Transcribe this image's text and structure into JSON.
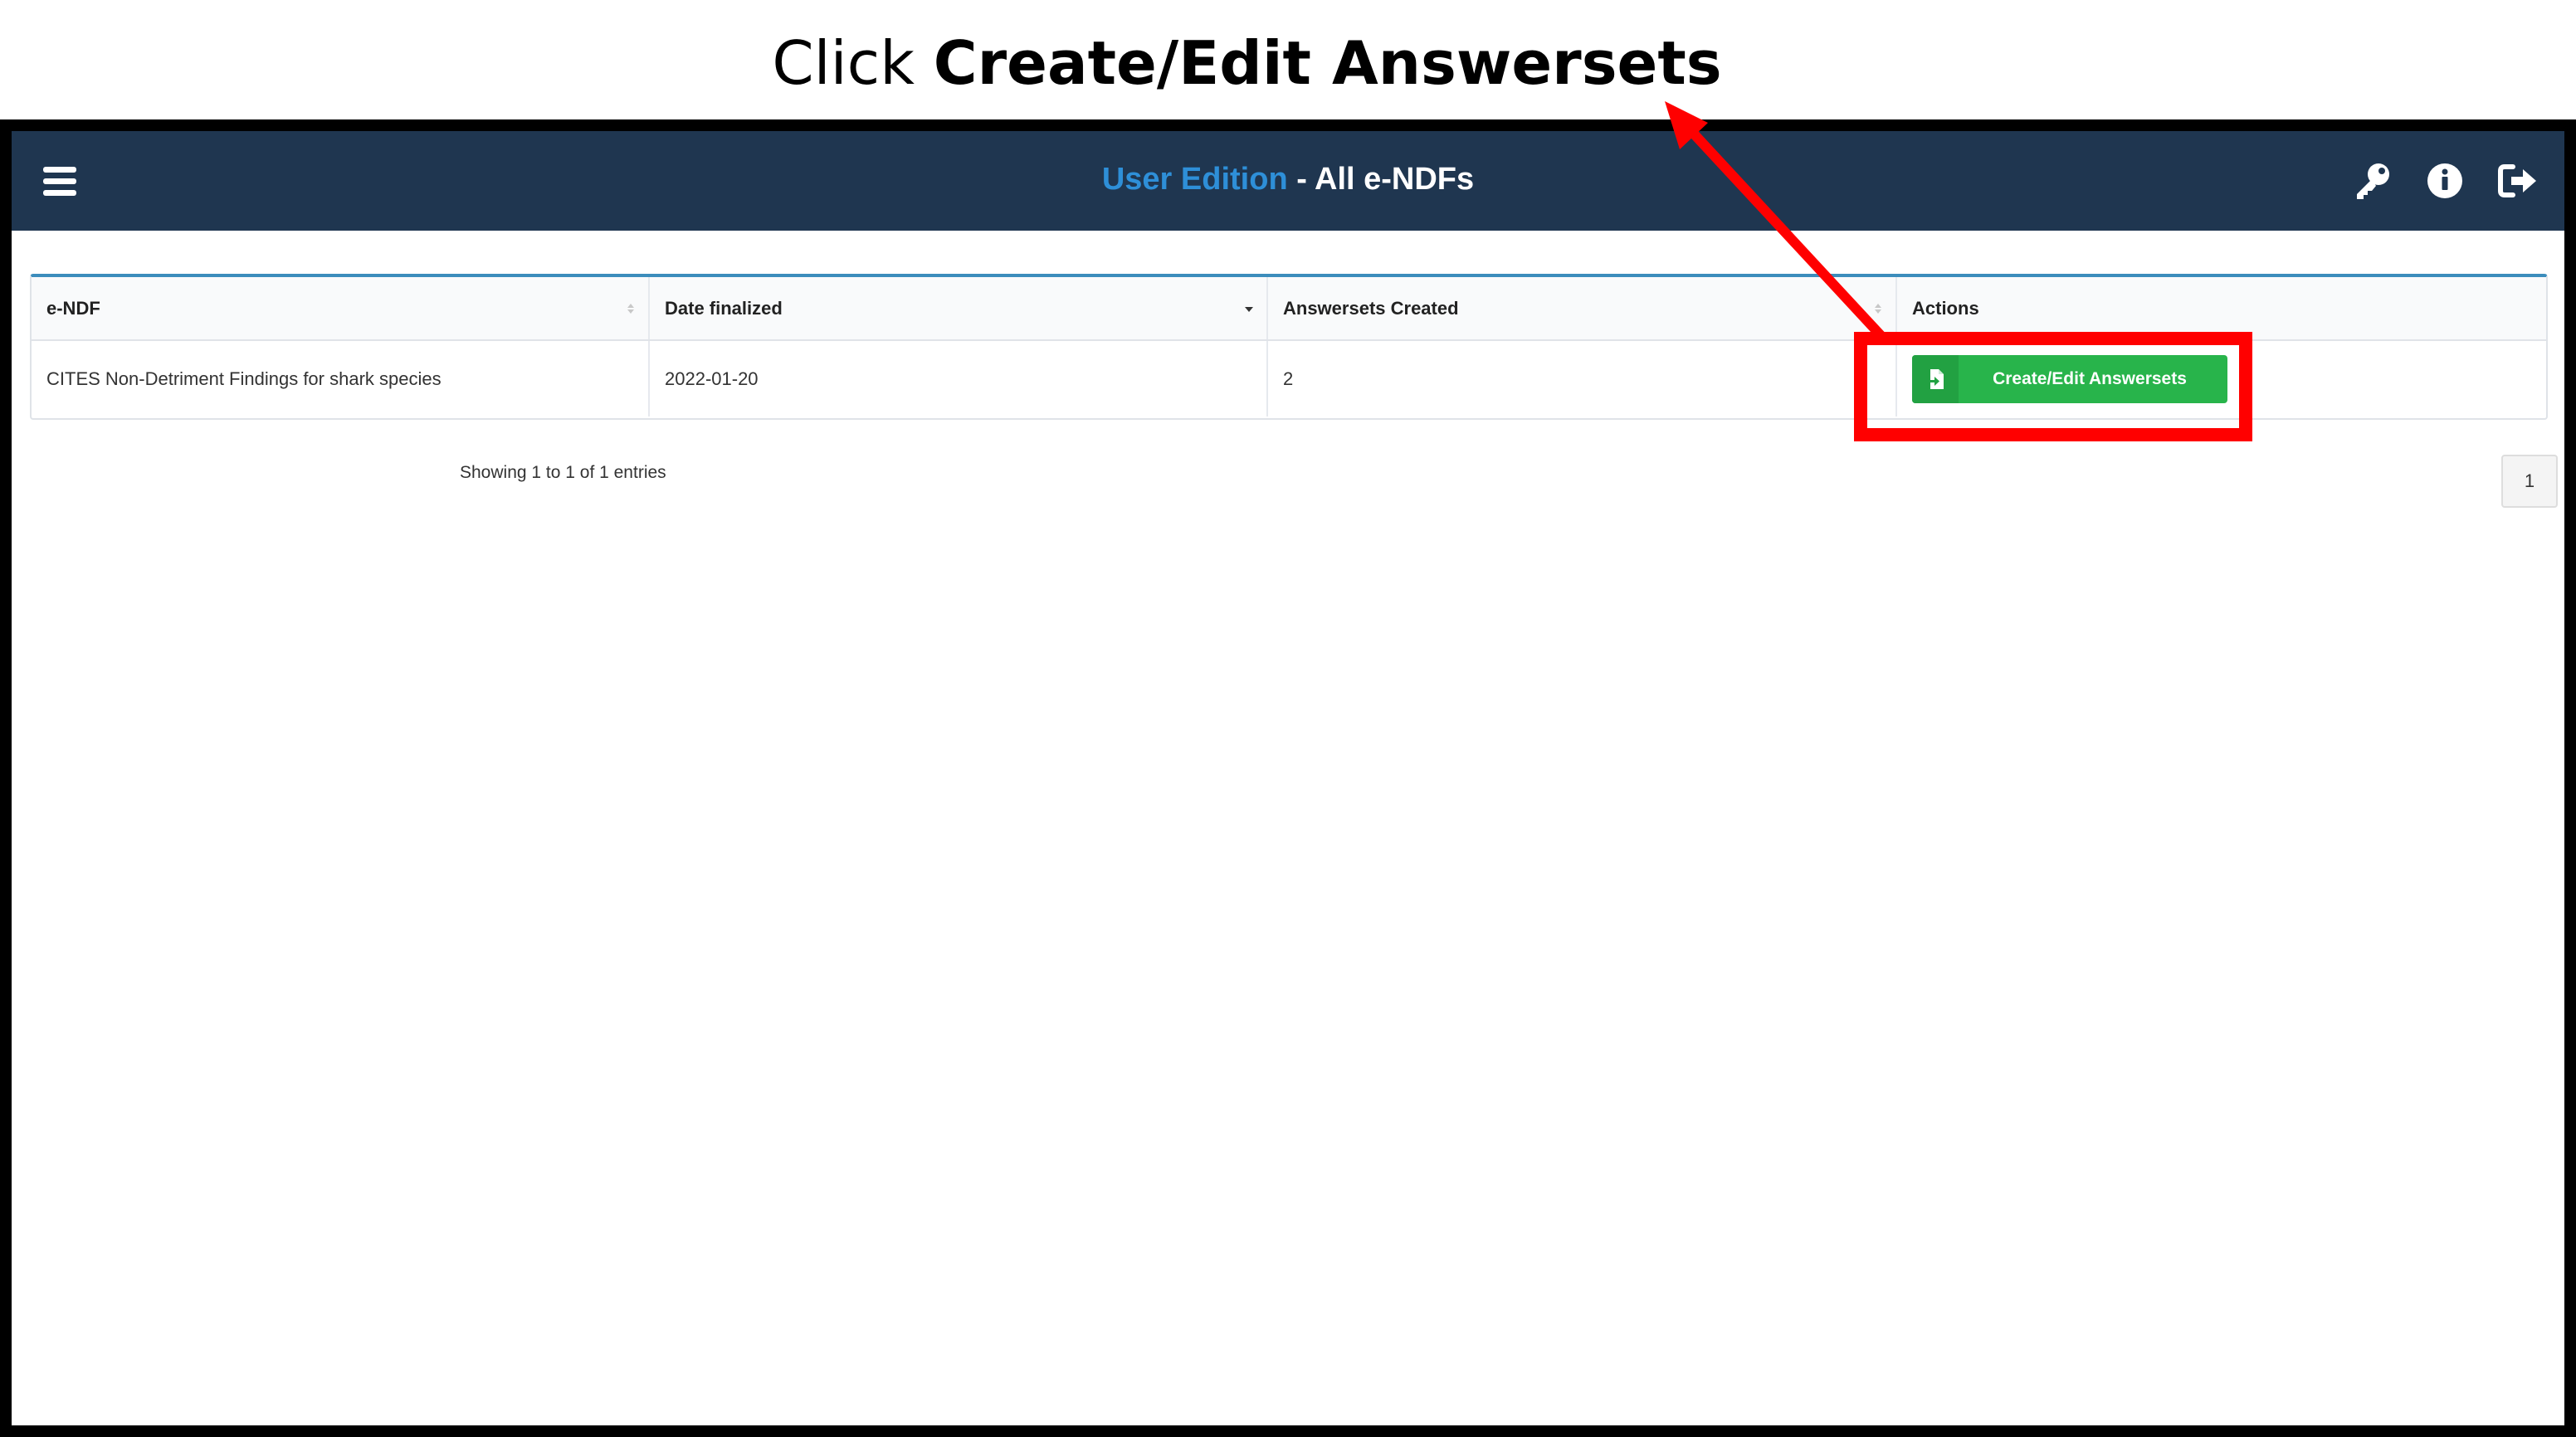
{
  "instruction": {
    "prefix": "Click ",
    "emphasis": "Create/Edit Answersets"
  },
  "navbar": {
    "title_highlight": "User Edition",
    "title_rest": " - All e-NDFs",
    "menu_icon": "hamburger-menu-icon",
    "key_icon": "key-icon",
    "info_icon": "info-icon",
    "logout_icon": "logout-icon",
    "background": "#1f3650",
    "accent": "#2e8fd8"
  },
  "table": {
    "columns": [
      "e-NDF",
      "Date finalized",
      "Answersets Created",
      "Actions"
    ],
    "rows": [
      {
        "endf": "CITES Non-Detriment Findings for shark species",
        "date_finalized": "2022-01-20",
        "answersets_created": "2",
        "action_label": "Create/Edit Answersets",
        "action_icon": "file-import-icon"
      }
    ]
  },
  "pagination": {
    "info": "Showing 1 to 1 of 1 entries",
    "current_page": "1"
  },
  "annotation": {
    "color": "#ff0000"
  }
}
